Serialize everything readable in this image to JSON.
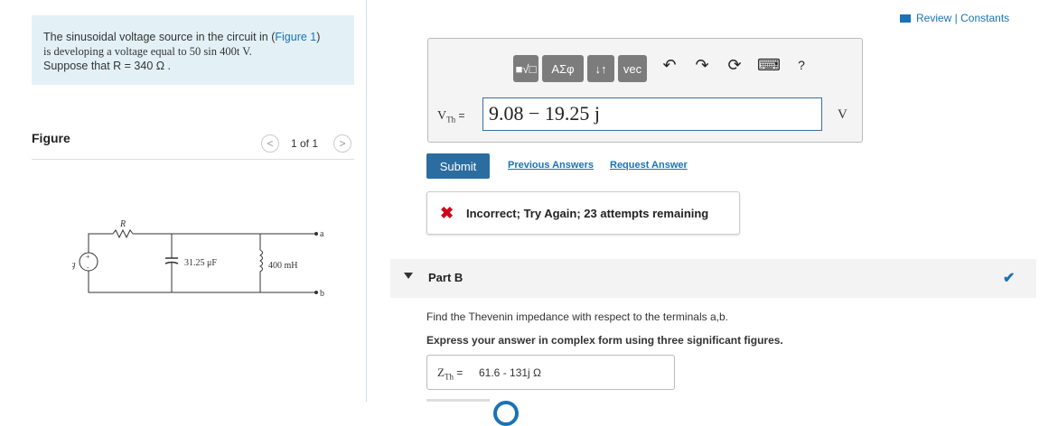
{
  "problem": {
    "text_before_link": "The sinusoidal voltage source in the circuit in (",
    "figure_link": "Figure 1",
    "text_after_link": ")",
    "line2": "is developing a voltage equal to 50 sin 400t V.",
    "line3": "Suppose that R = 340 Ω ."
  },
  "figure": {
    "heading": "Figure",
    "pager": "1 of 1",
    "prev_icon": "<",
    "next_icon": ">",
    "labels": {
      "source": "vg",
      "resistor": "R",
      "capacitor": "31.25 μF",
      "inductor": "400 mH",
      "terminal_a": "a",
      "terminal_b": "b",
      "plus": "+",
      "minus": "-"
    }
  },
  "header": {
    "review_link": "Review | Constants"
  },
  "toolbar": {
    "template_icon": "■√□",
    "greek_label": "ΑΣφ",
    "arrows_label": "↓↑",
    "vec_label": "vec",
    "undo_icon": "↶",
    "redo_icon": "↷",
    "reset_icon": "⟳",
    "keyboard_icon": "⌨",
    "help_icon": "?"
  },
  "part_a": {
    "label_main": "V",
    "label_sub": "Th",
    "label_eq": "=",
    "value": "9.08 − 19.25 j",
    "unit": "V",
    "submit": "Submit",
    "previous_answers": "Previous Answers",
    "request_answer": "Request Answer",
    "feedback_icon": "✖",
    "feedback": "Incorrect; Try Again; 23 attempts remaining"
  },
  "part_b": {
    "title": "Part B",
    "check_icon": "✔",
    "question": "Find the Thevenin impedance with respect to the terminals a,b.",
    "instruction": "Express your answer in complex form using three significant figures.",
    "label_main": "Z",
    "label_sub": "Th",
    "label_eq": "=",
    "value": "61.6 - 131j  Ω"
  },
  "colors": {
    "accent": "#1a73b6",
    "submit_bg": "#2b6da1",
    "error": "#d0021b",
    "problem_bg": "#e3f1f6"
  }
}
